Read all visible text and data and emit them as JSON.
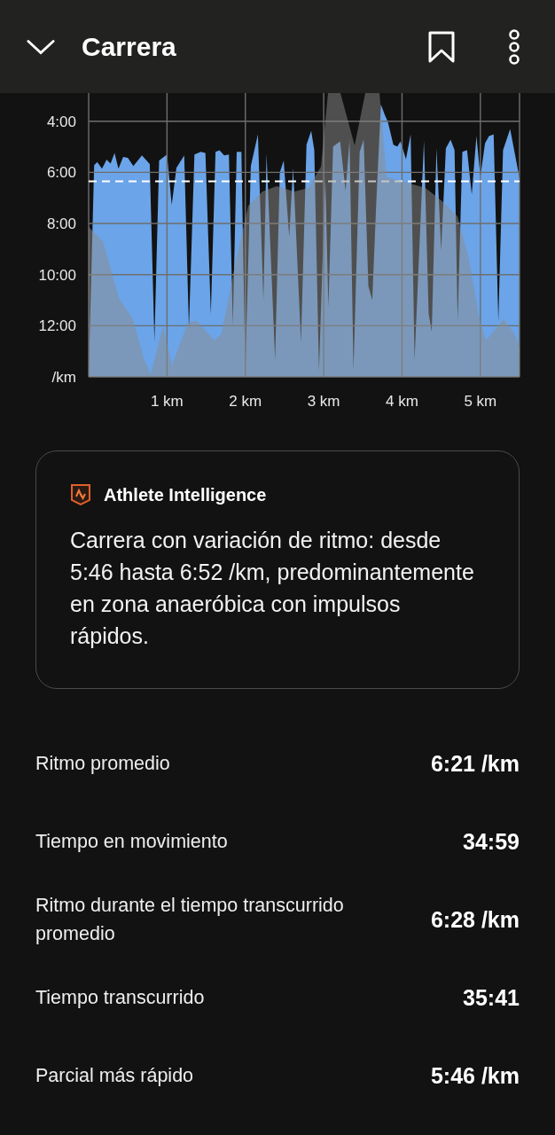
{
  "header": {
    "title": "Carrera"
  },
  "pace_chart": {
    "chart_data": {
      "type": "area",
      "x": [
        0,
        0.07,
        0.11,
        0.17,
        0.23,
        0.28,
        0.33,
        0.38,
        0.44,
        0.5,
        0.57,
        0.68,
        0.78,
        0.84,
        0.9,
        1.0,
        1.06,
        1.12,
        1.22,
        1.28,
        1.35,
        1.43,
        1.49,
        1.56,
        1.62,
        1.67,
        1.73,
        1.79,
        1.84,
        1.89,
        1.95,
        2.0,
        2.07,
        2.16,
        2.23,
        2.27,
        2.38,
        2.44,
        2.49,
        2.56,
        2.61,
        2.71,
        2.78,
        2.84,
        2.88,
        2.94,
        3.02,
        3.06,
        3.12,
        3.21,
        3.28,
        3.33,
        3.38,
        3.46,
        3.51,
        3.57,
        3.62,
        3.67,
        3.73,
        3.78,
        3.82,
        3.89,
        3.94,
        3.98,
        4.05,
        4.11,
        4.16,
        4.28,
        4.34,
        4.38,
        4.44,
        4.5,
        4.56,
        4.62,
        4.67,
        4.71,
        4.77,
        4.83,
        4.89,
        4.95,
        5.0,
        5.06,
        5.11,
        5.17,
        5.23,
        5.29,
        5.38,
        5.5,
        5.5
      ],
      "series": [
        {
          "color": "#6ba4e8",
          "values": [
            14,
            5.72,
            5.6,
            5.86,
            5.5,
            5.66,
            5.24,
            5.86,
            5.4,
            5.43,
            5.75,
            5.34,
            5.68,
            12.58,
            5.54,
            5.3,
            7.27,
            5.82,
            5.34,
            12.1,
            5.3,
            5.2,
            5.24,
            11.54,
            5.2,
            5.14,
            5.34,
            5.3,
            11.96,
            5.2,
            5.2,
            13.75,
            5.75,
            4.51,
            11.0,
            5.27,
            13.34,
            6.0,
            5.54,
            8.51,
            5.82,
            12.65,
            4.92,
            4.37,
            5.13,
            13.75,
            6.17,
            11.27,
            4.99,
            4.79,
            6.72,
            4.72,
            13.75,
            5.2,
            4.72,
            10.44,
            11.0,
            7.27,
            3.34,
            3.75,
            4.03,
            4.92,
            4.99,
            4.79,
            5.48,
            4.51,
            13.34,
            4.76,
            11.54,
            12.23,
            5.06,
            9.06,
            5.06,
            4.72,
            5.13,
            11.82,
            5.2,
            5.13,
            6.86,
            4.58,
            6.17,
            4.86,
            4.58,
            4.51,
            11.82,
            5.13,
            4.3,
            6.23,
            14
          ]
        }
      ],
      "xlim": [
        0,
        5.5
      ],
      "ylim": [
        14,
        2.9
      ],
      "xticks": [
        {
          "value": 1,
          "label": "1 km"
        },
        {
          "value": 2,
          "label": "2 km"
        },
        {
          "value": 3,
          "label": "3 km"
        },
        {
          "value": 4,
          "label": "4 km"
        },
        {
          "value": 5,
          "label": "5 km"
        }
      ],
      "yticks": [
        {
          "value": 4,
          "label": "4:00"
        },
        {
          "value": 6,
          "label": "6:00"
        },
        {
          "value": 8,
          "label": "8:00"
        },
        {
          "value": 10,
          "label": "10:00"
        },
        {
          "value": 12,
          "label": "12:00"
        },
        {
          "value": 14,
          "label": "/km"
        }
      ],
      "grid": true,
      "ref_lines": [
        {
          "axis": "y",
          "value": 6.35
        }
      ]
    }
  },
  "insight": {
    "title": "Athlete Intelligence",
    "text": "Carrera con variación de ritmo: desde 5:46 hasta 6:52 /km, predominantemente en zona anaeróbica con impulsos rápidos."
  },
  "stats": [
    {
      "label": "Ritmo promedio",
      "value": "6:21 /km"
    },
    {
      "label": "Tiempo en movimiento",
      "value": "34:59"
    },
    {
      "label": "Ritmo durante el tiempo transcurrido promedio",
      "value": "6:28 /km"
    },
    {
      "label": "Tiempo transcurrido",
      "value": "35:41"
    },
    {
      "label": "Parcial más rápido",
      "value": "5:46 /km"
    }
  ]
}
